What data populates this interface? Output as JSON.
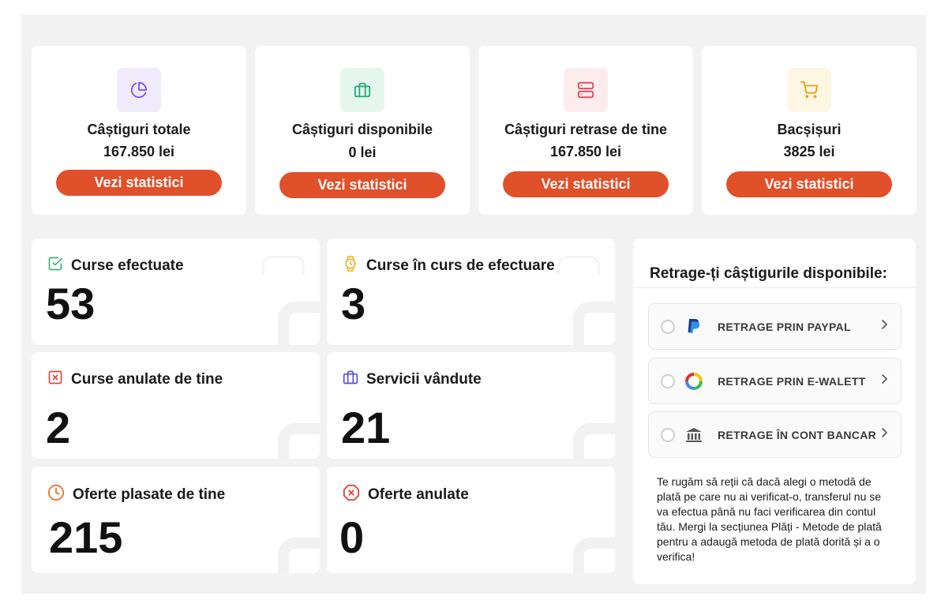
{
  "summary_cards": [
    {
      "title": "Câștiguri totale",
      "value": "167.850 lei",
      "button": "Vezi statistici",
      "icon": "pie-chart-icon",
      "icon_bg": "#efebfd",
      "icon_color": "#7c4dff"
    },
    {
      "title": "Câștiguri disponibile",
      "value": "0 lei",
      "button": "Vezi statistici",
      "icon": "briefcase-icon",
      "icon_bg": "#e5f6ef",
      "icon_color": "#27a77a"
    },
    {
      "title": "Câștiguri retrase de tine",
      "value": "167.850 lei",
      "button": "Vezi statistici",
      "icon": "server-icon",
      "icon_bg": "#fdecee",
      "icon_color": "#e2495c"
    },
    {
      "title": "Bacșișuri",
      "value": "3825 lei",
      "button": "Vezi statistici",
      "icon": "cart-icon",
      "icon_bg": "#fcf6e3",
      "icon_color": "#e2a614"
    }
  ],
  "stats": [
    {
      "label": "Curse efectuate",
      "value": "53",
      "icon": "check-square-icon",
      "icon_color": "#3cb371"
    },
    {
      "label": "Curse în curs de efectuare",
      "value": "3",
      "icon": "watch-icon",
      "icon_color": "#e8b923"
    },
    {
      "label": "Curse anulate de tine",
      "value": "2",
      "icon": "x-square-icon",
      "icon_color": "#e0463a"
    },
    {
      "label": "Servicii vândute",
      "value": "21",
      "icon": "briefcase-icon",
      "icon_color": "#5a4fd6"
    },
    {
      "label": "Oferte plasate de tine",
      "value": "215",
      "icon": "clock-icon",
      "icon_color": "#e8762e"
    },
    {
      "label": "Oferte anulate",
      "value": "0",
      "icon": "x-octagon-icon",
      "icon_color": "#e0463a"
    }
  ],
  "withdraw": {
    "title": "Retrage-ți câștigurile disponibile:",
    "options": [
      {
        "label": "RETRAGE PRIN PAYPAL",
        "icon": "paypal-icon"
      },
      {
        "label": "RETRAGE PRIN E-WALETT",
        "icon": "ewallet-ring-icon"
      },
      {
        "label": "RETRAGE ÎN CONT BANCAR",
        "icon": "bank-icon"
      }
    ],
    "note": "Te rugăm să reții că dacă alegi o metodă de plată pe care nu ai verificat-o, transferul nu se va efectua până nu faci verificarea din contul tău. Mergi la secțiunea Plăți - Metode de plată pentru a adaugă metoda de plată dorită și a o verifica!"
  },
  "colors": {
    "accent": "#e0502a",
    "background": "#f2f2f2",
    "card": "#ffffff"
  }
}
